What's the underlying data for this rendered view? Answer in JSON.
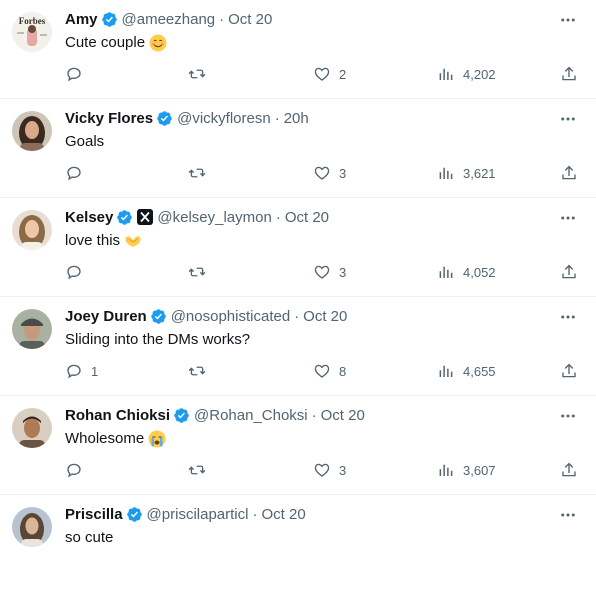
{
  "colors": {
    "verified": "#1d9bf0",
    "text": "#0f1419",
    "muted": "#536471",
    "divider": "#eff3f4"
  },
  "replies": [
    {
      "name": "Amy",
      "handle": "@ameezhang",
      "time": "Oct 20",
      "text": "Cute couple",
      "emoji": "smiling-face-emoji",
      "reply_count": "",
      "like_count": "2",
      "view_count": "4,202",
      "avatar": "forbes-avatar"
    },
    {
      "name": "Vicky Flores",
      "handle": "@vickyfloresn",
      "time": "20h",
      "text": "Goals",
      "emoji": "",
      "reply_count": "",
      "like_count": "3",
      "view_count": "3,621",
      "avatar": "woman-avatar"
    },
    {
      "name": "Kelsey",
      "handle": "@kelsey_laymon",
      "time": "Oct 20",
      "text": "love this",
      "emoji": "heart-hands-emoji",
      "affiliation": "x-logo-badge",
      "reply_count": "",
      "like_count": "3",
      "view_count": "4,052",
      "avatar": "woman-avatar"
    },
    {
      "name": "Joey Duren",
      "handle": "@nosophisticated",
      "time": "Oct 20",
      "text": "Sliding into the DMs works?",
      "emoji": "",
      "reply_count": "1",
      "like_count": "8",
      "view_count": "4,655",
      "avatar": "man-cap-avatar"
    },
    {
      "name": "Rohan Chioksi",
      "handle": "@Rohan_Choksi",
      "time": "Oct 20",
      "text": "Wholesome",
      "emoji": "crying-face-emoji",
      "reply_count": "",
      "like_count": "3",
      "view_count": "3,607",
      "avatar": "man-avatar"
    },
    {
      "name": "Priscilla",
      "handle": "@priscilaparticl",
      "time": "Oct 20",
      "text": "so cute",
      "emoji": "",
      "reply_count": "",
      "like_count": "",
      "view_count": "",
      "avatar": "woman-avatar"
    }
  ]
}
